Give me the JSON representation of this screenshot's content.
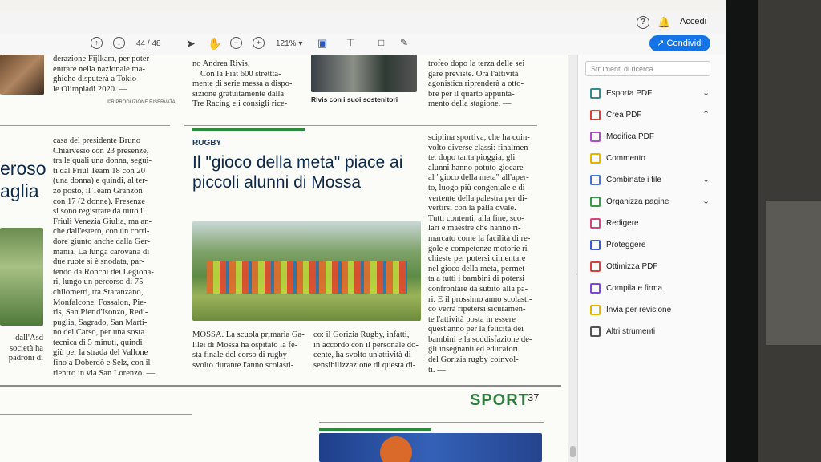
{
  "topbar": {
    "help": "?",
    "signin": "Accedi"
  },
  "toolbar": {
    "page_current": "44",
    "page_total": "/ 48",
    "zoom": "121%",
    "share": "Condividi"
  },
  "panel": {
    "search_placeholder": "Strumenti di ricerca",
    "tools": [
      {
        "label": "Esporta PDF",
        "color": "#2f8f8c",
        "chev": "⌄"
      },
      {
        "label": "Crea PDF",
        "color": "#d9423b",
        "chev": "⌃"
      },
      {
        "label": "Modifica PDF",
        "color": "#b04bcf",
        "chev": ""
      },
      {
        "label": "Commento",
        "color": "#e8b400",
        "chev": ""
      },
      {
        "label": "Combinate i file",
        "color": "#4674d6",
        "chev": "⌄"
      },
      {
        "label": "Organizza pagine",
        "color": "#3b9a48",
        "chev": "⌄"
      },
      {
        "label": "Redigere",
        "color": "#d9427a",
        "chev": ""
      },
      {
        "label": "Proteggere",
        "color": "#3b5bd6",
        "chev": ""
      },
      {
        "label": "Ottimizza PDF",
        "color": "#d9423b",
        "chev": ""
      },
      {
        "label": "Compila e firma",
        "color": "#7a4bd6",
        "chev": ""
      },
      {
        "label": "Invia per revisione",
        "color": "#e8b400",
        "chev": ""
      },
      {
        "label": "Altri strumenti",
        "color": "#555555",
        "chev": ""
      }
    ]
  },
  "doc": {
    "credit": "©RIPRODUZIONE RISERVATA",
    "top_left_col": [
      "derazione Fijlkam, per poter",
      "entrare nella nazionale ma-",
      "ghiche disputerà a Tokio",
      "le Olimpiadi 2020. —"
    ],
    "top_mid_col": [
      "no Andrea Rivis.",
      "Con la Fiat 600 strettta-",
      "mente di serie messa a dispo-",
      "sizione gratuitamente dalla",
      "Tre Racing e i consigli rice-"
    ],
    "photo_caption": "Rivis con i suoi sostenitori",
    "top_right_col": [
      "trofeo dopo la terza delle sei",
      "gare previste. Ora l'attività",
      "agonistica riprenderà a otto-",
      "bre per il quarto appunta-",
      "mento della stagione. —"
    ],
    "big_left": [
      "eroso",
      "aglia"
    ],
    "left_bottom": [
      "dall'Asd",
      "società ha",
      "padroni di"
    ],
    "kicker": "RUGBY",
    "headline": "Il \"gioco della meta\" piace ai piccoli alunni di Mossa",
    "col2": [
      "casa del presidente Bruno",
      "Chiarvesio con 23 presenze,",
      "tra le quali una donna, seguì-",
      "ti dal Friul Team 18 con 20",
      "(una donna) e quindi, al ter-",
      "zo posto, il Team Granzon",
      "con 17 (2 donne). Presenze",
      "si sono registrate da tutto il",
      "Friuli Venezia Giulia, ma an-",
      "che dall'estero, con un corri-",
      "dore giunto anche dalla Ger-",
      "mania. La lunga carovana di",
      "due ruote si è snodata, par-",
      "tendo da Ronchi dei Legiona-",
      "ri, lungo un percorso di 75",
      "chilometri, tra Staranzano,",
      "Monfalcone, Fossalon, Pie-",
      "ris, San Pier d'Isonzo, Redi-",
      "puglia, Sagrado, San Marti-",
      "no del Carso, per una sosta",
      "tecnica di 5 minuti, quindi",
      "giù per la strada del Vallone",
      "fino a Doberdò e Selz, con il",
      "rientro in via San Lorenzo. —"
    ],
    "col4": [
      "sciplina sportiva, che ha coin-",
      "volto diverse classi: finalmen-",
      "te, dopo tanta pioggia, gli",
      "alunni hanno potuto giocare",
      "al \"gioco della meta\" all'aper-",
      "to, luogo più congeniale e di-",
      "vertente della palestra per di-",
      "vertirsi con la palla ovale.",
      "Tutti contenti, alla fine, sco-",
      "lari e maestre che hanno ri-",
      "marcato come la facilità di re-",
      "gole e competenze motorie ri-",
      "chieste per potersi cimentare",
      "nel gioco della meta, permet-",
      "ta a tutti i bambini di potersi",
      "confrontare da subito alla pa-",
      "ri. E il prossimo anno scolasti-",
      "co verrà ripetersi sicuramen-",
      "te l'attività posta in essere",
      "quest'anno per la felicità dei",
      "bambini e la soddisfazione de-",
      "gli insegnanti ed educatori",
      "del Gorizia rugby coinvol-",
      "ti. —"
    ],
    "body_a": [
      "MOSSA. La scuola primaria Ga-",
      "lilei di Mossa ha ospitato la fe-",
      "sta finale del corso di rugby",
      "svolto durante l'anno scolasti-"
    ],
    "body_b": [
      "co: il Gorizia Rugby, infatti,",
      "in accordo con il personale do-",
      "cente, ha svolto un'attività di",
      "sensibilizzazione di questa di-"
    ],
    "section": "SPORT",
    "page_number": "37"
  }
}
